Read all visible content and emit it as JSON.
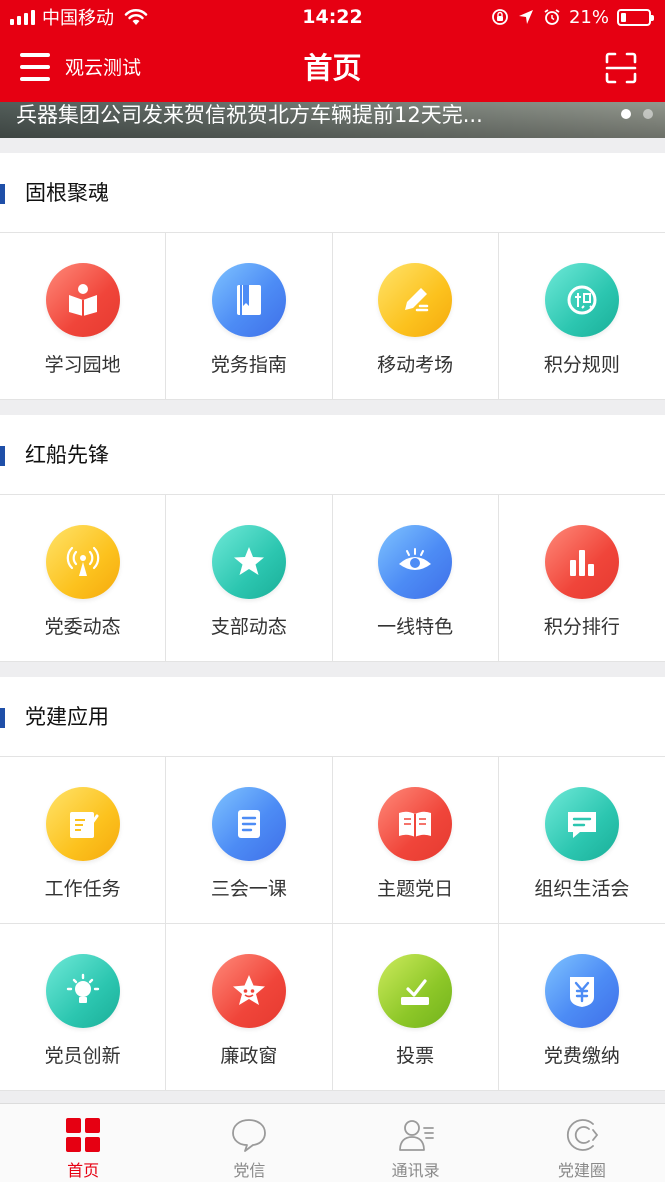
{
  "status_bar": {
    "carrier": "中国移动",
    "time": "14:22",
    "battery_text": "21%",
    "battery_level": 0.21
  },
  "nav": {
    "org_name": "观云测试",
    "title": "首页"
  },
  "banner": {
    "headline": "兵器集团公司发来贺信祝贺北方车辆提前12天完...",
    "slide_count": 2,
    "active_slide": 1
  },
  "sections": [
    {
      "title": "固根聚魂",
      "items": [
        {
          "label": "学习园地",
          "icon": "reading-icon",
          "color": "red"
        },
        {
          "label": "党务指南",
          "icon": "guide-book-icon",
          "color": "blue"
        },
        {
          "label": "移动考场",
          "icon": "pencil-exam-icon",
          "color": "yellow"
        },
        {
          "label": "积分规则",
          "icon": "points-rule-icon",
          "color": "teal"
        }
      ]
    },
    {
      "title": "红船先锋",
      "items": [
        {
          "label": "党委动态",
          "icon": "broadcast-icon",
          "color": "yellow"
        },
        {
          "label": "支部动态",
          "icon": "star-icon",
          "color": "teal"
        },
        {
          "label": "一线特色",
          "icon": "eye-icon",
          "color": "blue"
        },
        {
          "label": "积分排行",
          "icon": "bar-chart-icon",
          "color": "red"
        }
      ]
    },
    {
      "title": "党建应用",
      "items": [
        {
          "label": "工作任务",
          "icon": "task-note-icon",
          "color": "yellow"
        },
        {
          "label": "三会一课",
          "icon": "document-icon",
          "color": "blue"
        },
        {
          "label": "主题党日",
          "icon": "open-book-icon",
          "color": "red"
        },
        {
          "label": "组织生活会",
          "icon": "chat-bubble-icon",
          "color": "teal"
        },
        {
          "label": "党员创新",
          "icon": "lightbulb-icon",
          "color": "teal"
        },
        {
          "label": "廉政窗",
          "icon": "smiling-star-icon",
          "color": "red"
        },
        {
          "label": "投票",
          "icon": "ballot-box-icon",
          "color": "green"
        },
        {
          "label": "党费缴纳",
          "icon": "yuan-payment-icon",
          "color": "blue"
        }
      ]
    }
  ],
  "tabbar": {
    "tabs": [
      {
        "label": "首页",
        "icon": "home-grid-icon",
        "active": true
      },
      {
        "label": "党信",
        "icon": "message-bubble-icon",
        "active": false
      },
      {
        "label": "通讯录",
        "icon": "contacts-icon",
        "active": false
      },
      {
        "label": "党建圈",
        "icon": "circle-icon",
        "active": false
      }
    ]
  },
  "colors": {
    "brand_red": "#e60012",
    "section_bar_blue": "#1f4fa8",
    "tab_inactive": "#8a8a8a"
  }
}
